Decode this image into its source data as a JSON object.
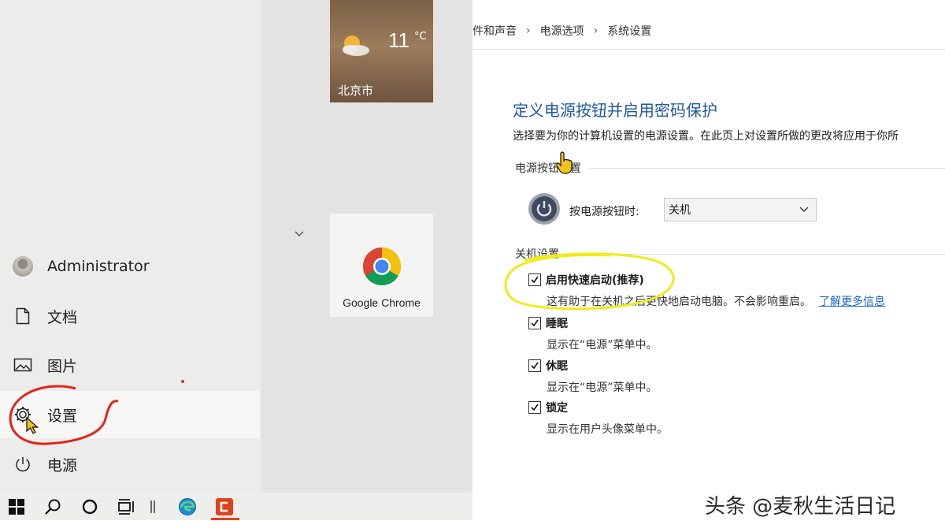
{
  "start_menu": {
    "user": "Administrator",
    "items": [
      {
        "label": "文档",
        "icon": "document-icon"
      },
      {
        "label": "图片",
        "icon": "picture-icon"
      },
      {
        "label": "设置",
        "icon": "gear-icon"
      },
      {
        "label": "电源",
        "icon": "power-icon"
      }
    ],
    "weather_tile": {
      "temperature": "11",
      "unit": "°C",
      "city": "北京市"
    },
    "chrome_tile": {
      "label": "Google Chrome"
    }
  },
  "taskbar": {
    "icons": [
      "windows-start-icon",
      "search-icon",
      "cortana-icon",
      "task-view-icon",
      "divider",
      "edge-icon",
      "app-icon"
    ]
  },
  "power_options": {
    "breadcrumb": [
      "件和声音",
      "电源选项",
      "系统设置"
    ],
    "title": "定义电源按钮并启用密码保护",
    "description": "选择要为你的计算机设置的电源设置。在此页上对设置所做的更改将应用于你所",
    "section_buttons": "电源按钮设置",
    "power_button_label": "按电源按钮时:",
    "power_button_value": "关机",
    "section_shutdown": "关机设置",
    "options": [
      {
        "name": "启用快速启动(推荐)",
        "desc": "这有助于在关机之后更快地启动电脑。不会影响重启。",
        "link": "了解更多信息",
        "checked": true
      },
      {
        "name": "睡眠",
        "desc": "显示在“电源”菜单中。",
        "checked": true
      },
      {
        "name": "休眠",
        "desc": "显示在“电源”菜单中。",
        "checked": true
      },
      {
        "name": "锁定",
        "desc": "显示在用户头像菜单中。",
        "checked": true
      }
    ]
  },
  "watermark": "头条 @麦秋生活日记",
  "colors": {
    "title_blue": "#1e5a9c",
    "link_blue": "#1a64c5",
    "annotation_red": "#e0251b",
    "annotation_yellow": "#f2ea1a"
  }
}
